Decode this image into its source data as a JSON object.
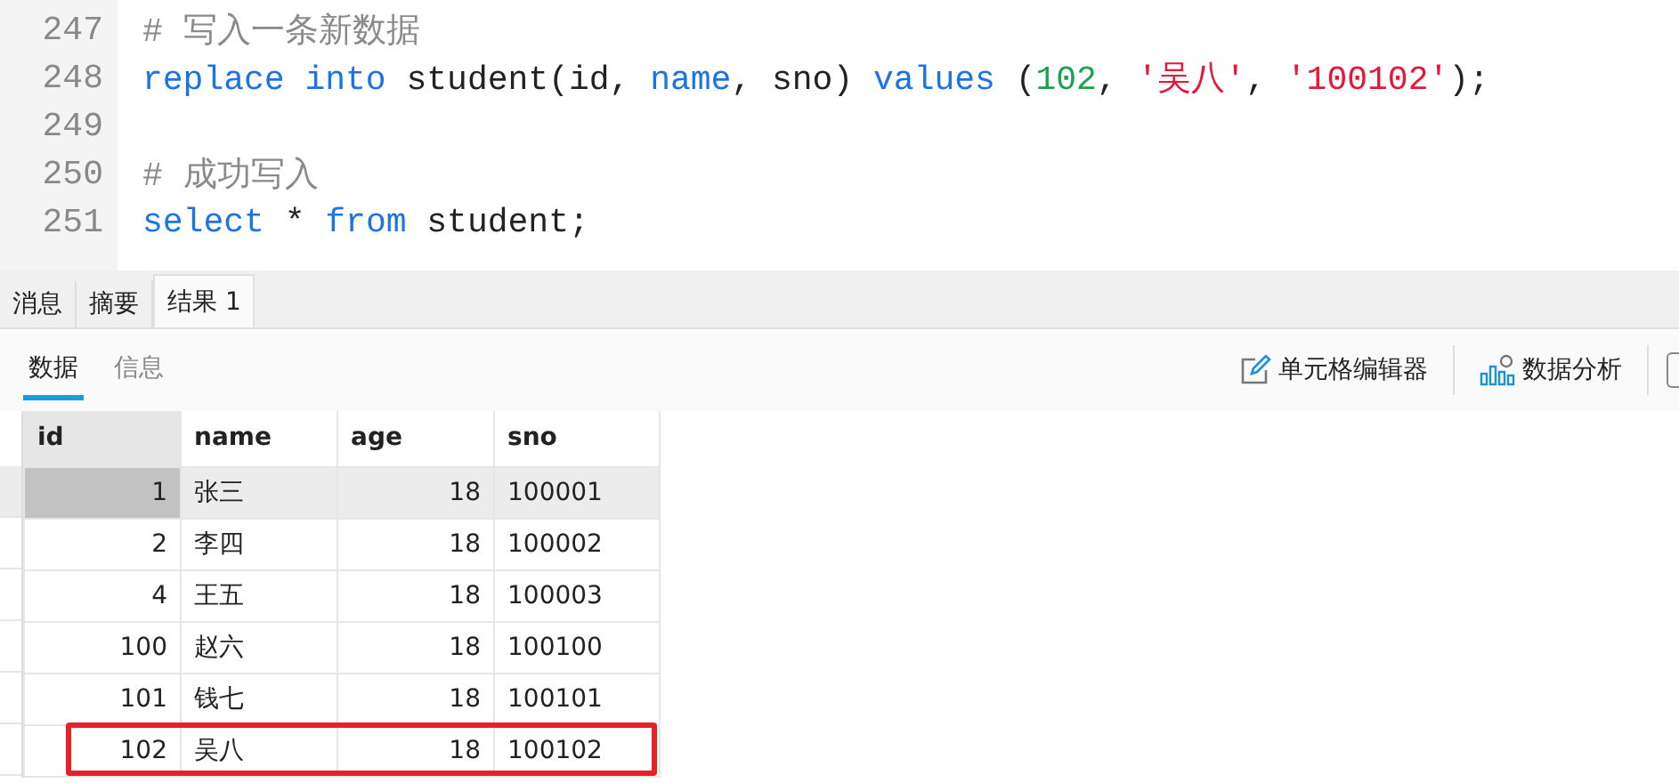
{
  "editor": {
    "lines": [
      {
        "number": "247",
        "tokens": [
          {
            "kind": "comment",
            "text": "# 写入一条新数据"
          }
        ]
      },
      {
        "number": "248",
        "tokens": [
          {
            "kind": "keyword",
            "text": "replace"
          },
          {
            "kind": "keyword",
            "text": " into"
          },
          {
            "kind": "plain",
            "text": " student(id, "
          },
          {
            "kind": "keyword",
            "text": "name"
          },
          {
            "kind": "plain",
            "text": ", sno) "
          },
          {
            "kind": "keyword",
            "text": "values"
          },
          {
            "kind": "plain",
            "text": " ("
          },
          {
            "kind": "number",
            "text": "102"
          },
          {
            "kind": "plain",
            "text": ", "
          },
          {
            "kind": "string",
            "text": "'吴八'"
          },
          {
            "kind": "plain",
            "text": ", "
          },
          {
            "kind": "string",
            "text": "'100102'"
          },
          {
            "kind": "plain",
            "text": ");"
          }
        ]
      },
      {
        "number": "249"
      },
      {
        "number": "250",
        "tokens": [
          {
            "kind": "comment",
            "text": "# 成功写入"
          }
        ]
      },
      {
        "number": "251",
        "tokens": [
          {
            "kind": "keyword",
            "text": "select"
          },
          {
            "kind": "plain",
            "text": " * "
          },
          {
            "kind": "keyword",
            "text": "from"
          },
          {
            "kind": "plain",
            "text": " student;"
          }
        ]
      }
    ]
  },
  "result_tabs": [
    {
      "label": "消息",
      "selected": false
    },
    {
      "label": "摘要",
      "selected": false
    },
    {
      "label": "结果 1",
      "selected": true
    }
  ],
  "view_tabs": [
    {
      "label": "数据",
      "selected": true
    },
    {
      "label": "信息",
      "selected": false
    }
  ],
  "toolbar": [
    {
      "kind": "edit",
      "label": "单元格编辑器"
    },
    {
      "kind": "analysis",
      "label": "数据分析"
    }
  ],
  "table": {
    "columns": [
      "id",
      "name",
      "age",
      "sno"
    ],
    "rows": [
      {
        "cells": [
          "1",
          "张三",
          "18",
          "100001"
        ],
        "selected": true,
        "highlighted": false
      },
      {
        "cells": [
          "2",
          "李四",
          "18",
          "100002"
        ],
        "selected": false,
        "highlighted": false
      },
      {
        "cells": [
          "4",
          "王五",
          "18",
          "100003"
        ],
        "selected": false,
        "highlighted": false
      },
      {
        "cells": [
          "100",
          "赵六",
          "18",
          "100100"
        ],
        "selected": false,
        "highlighted": false
      },
      {
        "cells": [
          "101",
          "钱七",
          "18",
          "100101"
        ],
        "selected": false,
        "highlighted": false
      },
      {
        "cells": [
          "102",
          "吴八",
          "18",
          "100102"
        ],
        "selected": false,
        "highlighted": true
      }
    ]
  }
}
